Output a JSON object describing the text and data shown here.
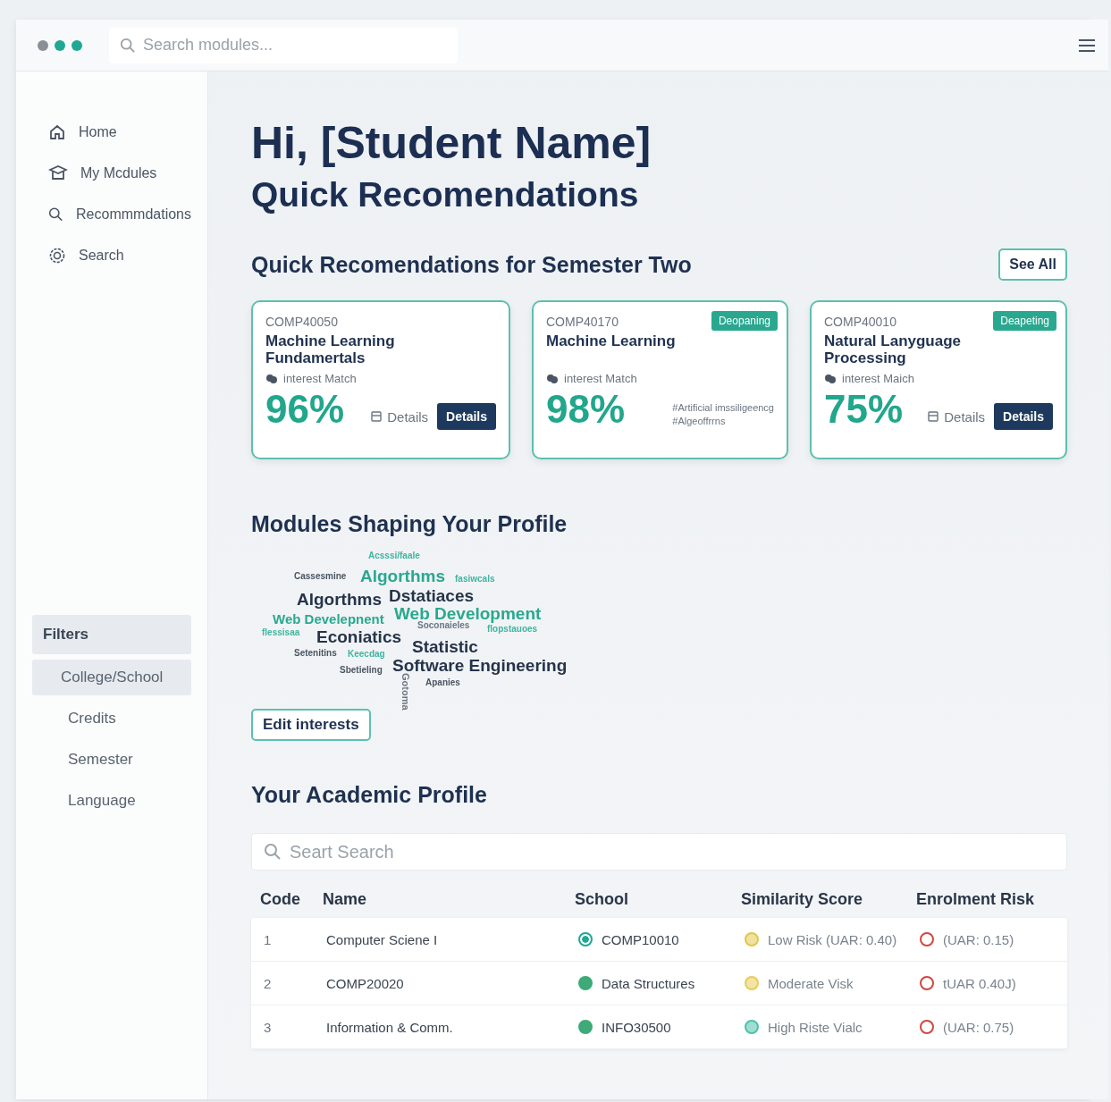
{
  "topbar": {
    "dots": [
      {
        "color": "#8a8f96"
      },
      {
        "color": "#1fa894"
      },
      {
        "color": "#1fa894"
      }
    ],
    "search": {
      "placeholder": "Search modules..."
    }
  },
  "sidebar": {
    "nav": [
      {
        "label": "Home"
      },
      {
        "label": "My Mcdules"
      },
      {
        "label": "Recommmdations"
      },
      {
        "label": "Search"
      }
    ],
    "filters_title": "Filters",
    "filters": [
      {
        "label": "College/School",
        "selected": true
      },
      {
        "label": "Credits",
        "selected": false
      },
      {
        "label": "Semester",
        "selected": false
      },
      {
        "label": "Language",
        "selected": false
      }
    ]
  },
  "greeting": "Hi, [Student Name]",
  "subtitle": "Quick Recomendations",
  "recommendations": {
    "title": "Quick Recomendations for Semester Two",
    "see_all": "See All",
    "cards": [
      {
        "code": "COMP40050",
        "title": "Machine Learning Fundamertals",
        "interest_label": "interest Match",
        "percent": "96%",
        "kind": "actions",
        "link": "Details",
        "button": "Details"
      },
      {
        "code": "COMP40170",
        "tag": "Deopaning",
        "title": "Machine Learning",
        "interest_label": "interest Match",
        "percent": "98%",
        "kind": "tags",
        "tags": [
          "#Artificial imssiligeencg",
          "#Algeoffrrns"
        ]
      },
      {
        "code": "COMP40010",
        "tag": "Deapeting",
        "title": "Natural Lanyguage Processing",
        "interest_label": "interest Maich",
        "percent": "75%",
        "kind": "actions",
        "link": "Details",
        "button": "Details"
      }
    ]
  },
  "shaping": {
    "title": "Modules Shaping Your Profile",
    "words": [
      {
        "text": "Acsssi/faale",
        "kind": "sm",
        "color": "#3fb5a0"
      },
      {
        "text": "Cassesmine",
        "kind": "sm",
        "color": "#4a5563"
      },
      {
        "text": "Algorthms",
        "kind": "lg",
        "color": "#2aa88f"
      },
      {
        "text": "fasiwcals",
        "kind": "sm",
        "color": "#3fb5a0"
      },
      {
        "text": "Algorthms",
        "kind": "lg",
        "color": "#26344a"
      },
      {
        "text": "Dstatiaces",
        "kind": "lg",
        "color": "#26344a"
      },
      {
        "text": "Web Develepnent",
        "kind": "md",
        "color": "#2aa88f"
      },
      {
        "text": "Web Development",
        "kind": "lg",
        "color": "#2aa88f"
      },
      {
        "text": "flessisaa",
        "kind": "sm",
        "color": "#3fb5a0"
      },
      {
        "text": "Econiatics",
        "kind": "lg",
        "color": "#26344a"
      },
      {
        "text": "Soconaieles",
        "kind": "sm",
        "color": "#6b7683"
      },
      {
        "text": "flopstauoes",
        "kind": "sm",
        "color": "#3fb5a0"
      },
      {
        "text": "Statistic",
        "kind": "lg",
        "color": "#26344a"
      },
      {
        "text": "Setenitins",
        "kind": "sm",
        "color": "#4a5563"
      },
      {
        "text": "Keecdag",
        "kind": "sm",
        "color": "#3fb5a0"
      },
      {
        "text": "Sbetieling",
        "kind": "sm",
        "color": "#4a5563"
      },
      {
        "text": "Software Engineering",
        "kind": "lg",
        "color": "#26344a"
      },
      {
        "text": "Apanies",
        "kind": "sm",
        "color": "#4a5563"
      },
      {
        "text": "Gotoma",
        "kind": "vertical",
        "color": "#6b7683"
      }
    ],
    "edit_button": "Edit interests"
  },
  "profile": {
    "title": "Your Academic Profile",
    "search": {
      "placeholder": "Seart Search"
    },
    "columns": [
      "Code",
      "Name",
      "School",
      "Similarity Score",
      "Enrolment Risk"
    ],
    "rows": [
      {
        "code": "1",
        "name": "Computer Sciene I",
        "school": {
          "kind": "ring",
          "color": "#1fa894",
          "text": "COMP10010"
        },
        "similarity": {
          "color": "#e2c64a",
          "text": "Low Risk (UAR: 0.40)"
        },
        "risk": {
          "color": "#d0473f",
          "text": "(UAR:   0.15)"
        }
      },
      {
        "code": "2",
        "name": "COMP20020",
        "school": {
          "kind": "filled",
          "color": "#3daa78",
          "text": "Data Structures"
        },
        "similarity": {
          "color": "#e8cc58",
          "text": "Moderate Visk"
        },
        "risk": {
          "color": "#d0473f",
          "text": "tUAR 0.40J)"
        }
      },
      {
        "code": "3",
        "name": "Information & Comm.",
        "school": {
          "kind": "filled",
          "color": "#3daa78",
          "text": "INFO30500"
        },
        "similarity": {
          "color": "#4cc2a8",
          "text": "High Riste Vialc"
        },
        "risk": {
          "color": "#d0473f",
          "text": "(UAR: 0.75)"
        }
      }
    ]
  }
}
